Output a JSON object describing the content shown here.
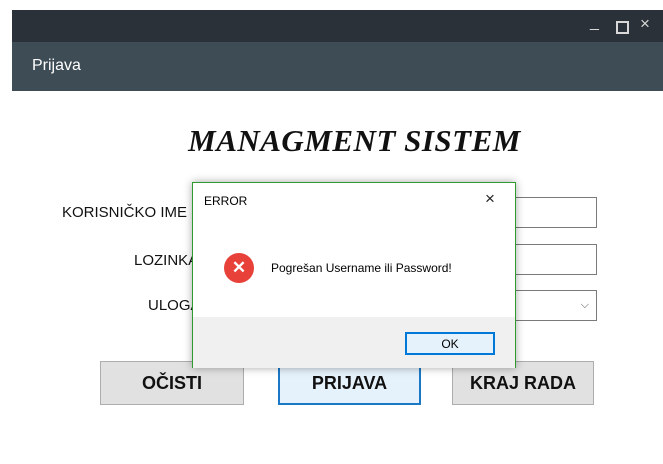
{
  "window": {
    "controls": {
      "minimize": "_",
      "close": "×"
    }
  },
  "header": {
    "title": "Prijava"
  },
  "main": {
    "title": "MANAGMENT SISTEM",
    "labels": {
      "username": "KORISNIČKO IME",
      "password": "LOZINKA",
      "role": "ULOGA"
    },
    "role_dropdown": {
      "chevron": "⌵"
    },
    "buttons": {
      "clear": "OČISTI",
      "login": "PRIJAVA",
      "exit": "KRAJ RADA"
    }
  },
  "dialog": {
    "title": "ERROR",
    "close": "×",
    "icon": "error-x-icon",
    "icon_glyph": "✕",
    "message": "Pogrešan Username ili Password!",
    "ok_label": "OK",
    "accent_color": "#e8413a"
  }
}
